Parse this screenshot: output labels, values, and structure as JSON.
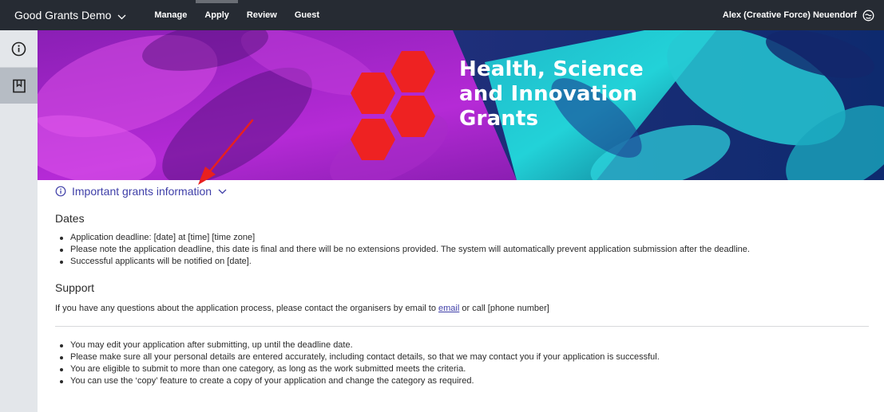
{
  "topnav": {
    "brand": "Good Grants Demo",
    "links": [
      "Manage",
      "Apply",
      "Review",
      "Guest"
    ],
    "active_link": "Apply",
    "user": "Alex (Creative Force) Neuendorf"
  },
  "sidebar": {
    "items": [
      {
        "icon": "info-circle-icon",
        "label": "Information"
      },
      {
        "icon": "bookmark-icon",
        "label": "Bookmark"
      }
    ]
  },
  "banner": {
    "title_lines": [
      "Health, Science",
      "and Innovation",
      "Grants"
    ],
    "logo_color": "#ee2222"
  },
  "info_toggle": {
    "label": "Important grants information"
  },
  "dates": {
    "heading": "Dates",
    "items": [
      "Application deadline: [date] at [time] [time zone]",
      "Please note the application deadline, this date is final and there will be no extensions provided. The system will automatically prevent application submission after the deadline.",
      "Successful applicants will be notified on [date]."
    ]
  },
  "support": {
    "heading": "Support",
    "text_before": "If you have any questions about the application process, please contact the organisers by email to ",
    "link": "email",
    "text_after": " or call [phone number]"
  },
  "notes": {
    "items": [
      "You may edit your application after submitting, up until the deadline date.",
      "Please make sure all your personal details are entered accurately, including contact details, so that we may contact you if your application is successful.",
      "You are eligible to submit to more than one category, as long as the work submitted meets the criteria.",
      "You can use the ‘copy’ feature to create a copy of your application and change the category as required."
    ]
  },
  "colors": {
    "nav_bg": "#262b33",
    "link": "#3f3fa8",
    "annotation_arrow": "#e8201f"
  }
}
